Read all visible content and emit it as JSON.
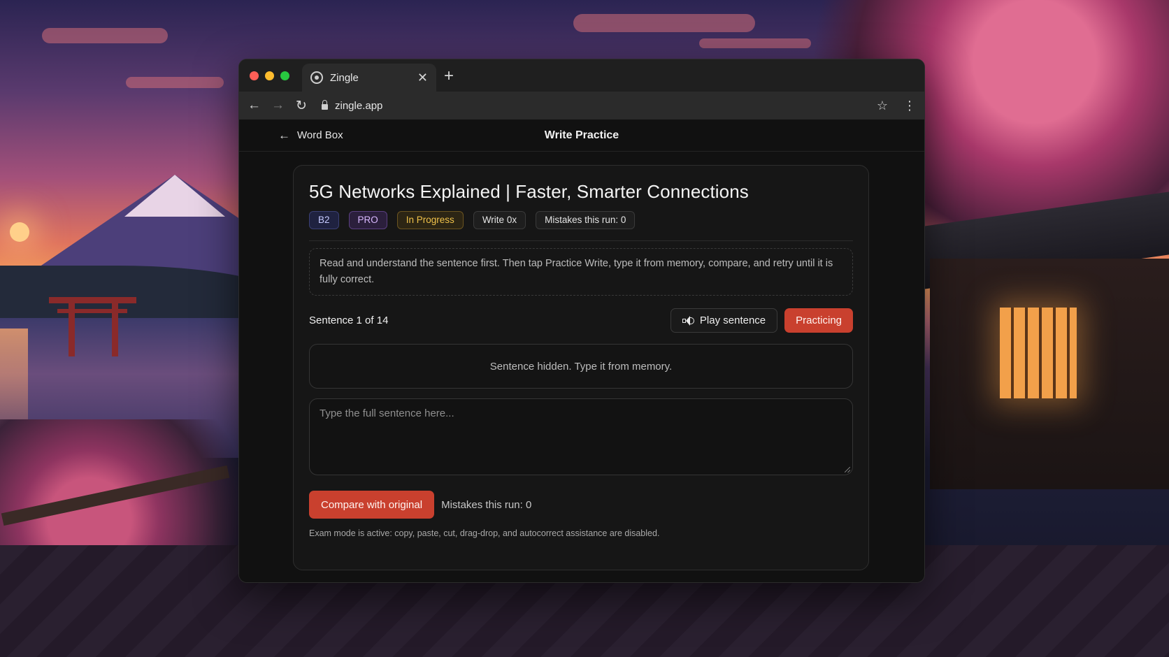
{
  "browser": {
    "tab_title": "Zingle",
    "tab_close_icon": "close-icon",
    "new_tab_icon": "plus-icon",
    "url": "zingle.app"
  },
  "header": {
    "back_label": "Word Box",
    "title": "Write Practice"
  },
  "lesson": {
    "title": "5G Networks Explained | Faster, Smarter Connections",
    "badges": {
      "level": "B2",
      "plan": "PRO",
      "status": "In Progress",
      "write_count": "Write 0x",
      "mistakes": "Mistakes this run: 0"
    },
    "instructions": "Read and understand the sentence first. Then tap Practice Write, type it from memory, compare, and retry until it is fully correct.",
    "sentence_counter": "Sentence 1 of 14",
    "play_label": "Play sentence",
    "practicing_label": "Practicing",
    "hidden_message": "Sentence hidden. Type it from memory.",
    "answer_placeholder": "Type the full sentence here...",
    "compare_label": "Compare with original",
    "mistakes_inline": "Mistakes this run: 0",
    "exam_note": "Exam mode is active: copy, paste, cut, drag-drop, and autocorrect assistance are disabled."
  },
  "colors": {
    "accent": "#c9402e",
    "status_badge": "#f0c24a",
    "level_badge": "#c6cbff",
    "plan_badge": "#d9b8ff"
  }
}
